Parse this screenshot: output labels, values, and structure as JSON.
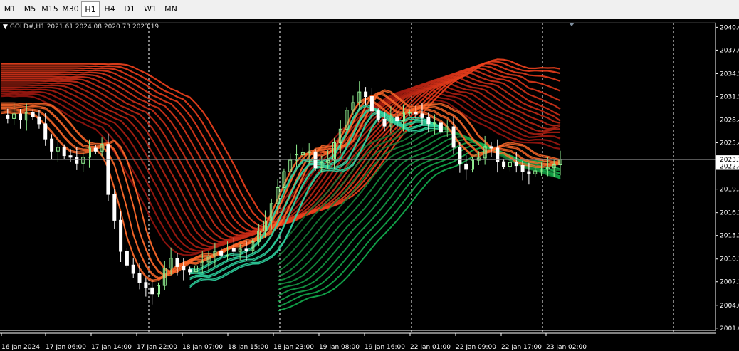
{
  "toolbar": {
    "timeframes": [
      {
        "label": "M1",
        "active": false
      },
      {
        "label": "M5",
        "active": false
      },
      {
        "label": "M15",
        "active": false
      },
      {
        "label": "M30",
        "active": false
      },
      {
        "label": "H1",
        "active": true
      },
      {
        "label": "H4",
        "active": false
      },
      {
        "label": "D1",
        "active": false
      },
      {
        "label": "W1",
        "active": false
      },
      {
        "label": "MN",
        "active": false
      }
    ]
  },
  "legend": {
    "symbol": "GOLD#,H1",
    "ohlc": "2021.61 2024.08 2020.73 2023.19"
  },
  "colors": {
    "background": "#000000",
    "grid": "#ffffff",
    "axis": "#ffffff",
    "bull_candle": "#90ee90",
    "bear_candle": "#ffffff",
    "bear_ribbon": "#b41a10",
    "bull_ribbon": "#2ecc71",
    "fast_orange": "#ff6a2a",
    "fast_teal": "#2fd3a0"
  },
  "chart_data": {
    "type": "candlestick",
    "symbol": "GOLD#",
    "timeframe": "H1",
    "current_price": "2023.19",
    "price_label_current": "2023.1",
    "price_label_second": "2022.4",
    "y_ticks": [
      "2040.6",
      "2037.6",
      "2034.5",
      "2031.5",
      "2028.4",
      "2025.4",
      "2022.4",
      "2019.3",
      "2016.2",
      "2013.2",
      "2010.1",
      "2007.1",
      "2004.0",
      "2001.0"
    ],
    "ylim": [
      2000.7,
      2041.2
    ],
    "x_labels": [
      "16 Jan 2024",
      "17 Jan 06:00",
      "17 Jan 14:00",
      "17 Jan 22:00",
      "18 Jan 07:00",
      "18 Jan 15:00",
      "18 Jan 23:00",
      "19 Jan 08:00",
      "19 Jan 16:00",
      "22 Jan 01:00",
      "22 Jan 09:00",
      "22 Jan 17:00",
      "23 Jan 02:00"
    ],
    "grid": "vertical dashed",
    "close_path": [
      2029,
      2028.6,
      2029.2,
      2028.4,
      2029.4,
      2028.8,
      2027.9,
      2025.9,
      2024.3,
      2024.8,
      2023.7,
      2023.5,
      2022.7,
      2023.5,
      2024.7,
      2024.3,
      2025.2,
      2018.6,
      2015.2,
      2011.1,
      2009.3,
      2008.2,
      2007,
      2006.3,
      2005.5,
      2006.6,
      2008.9,
      2010.2,
      2009.1,
      2008.7,
      2008.4,
      2009.2,
      2009.7,
      2010.5,
      2011.1,
      2010.6,
      2011.5,
      2011.1,
      2011.4,
      2011.2,
      2012.4,
      2013.8,
      2015.1,
      2017.4,
      2019.5,
      2021.6,
      2023.1,
      2023.8,
      2024.1,
      2024.2,
      2022.1,
      2022.8,
      2023.1,
      2025.4,
      2027.2,
      2029.7,
      2030.7,
      2032.1,
      2031.5,
      2029.6,
      2028.5,
      2027.6,
      2028.8,
      2028.3,
      2029.3,
      2029.4,
      2029.2,
      2028.7,
      2027.9,
      2028,
      2026.8,
      2027.5,
      2024.8,
      2022.6,
      2021.9,
      2023.1,
      2023.4,
      2024.9,
      2024.7,
      2022.9,
      2022.3,
      2022.8,
      2022.4,
      2021.6,
      2021.3,
      2021.7,
      2021.9,
      2022.1,
      2022.5,
      2023.2
    ],
    "ribbons": [
      {
        "name": "bear-ribbon",
        "color": "red",
        "spread": 4.2,
        "offset": 2.6
      },
      {
        "name": "fast-orange",
        "color": "orange",
        "spread": 1.2,
        "offset": 0.4
      },
      {
        "name": "fast-teal",
        "color": "teal",
        "spread": 1.4,
        "offset": -0.3
      }
    ]
  }
}
